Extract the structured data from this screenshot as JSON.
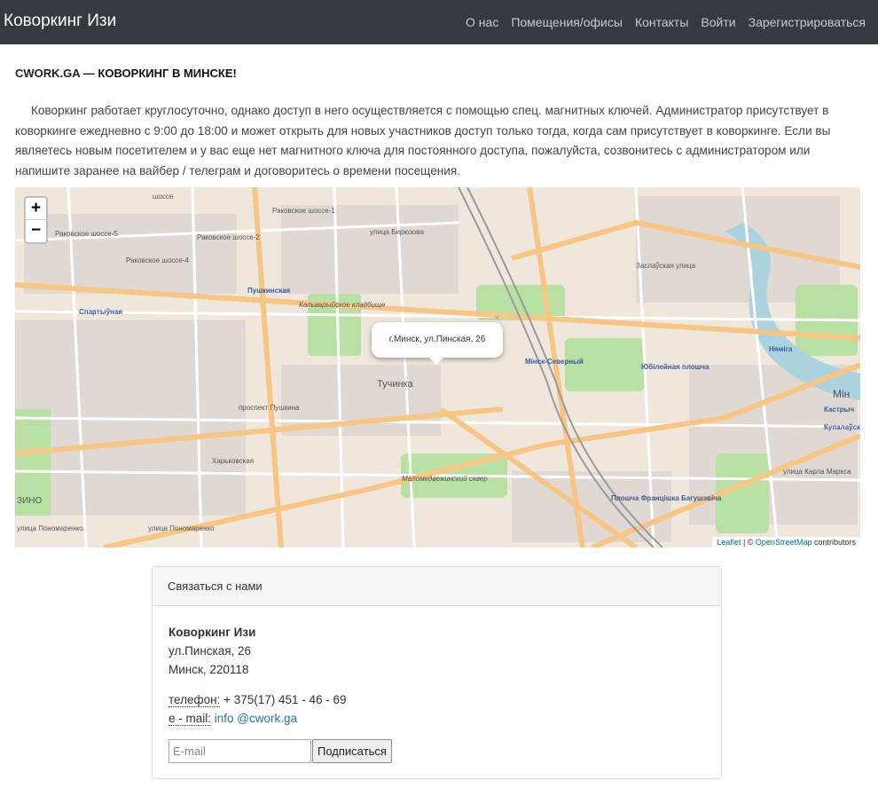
{
  "navbar": {
    "brand": "Коворкинг Изи",
    "links": [
      "О нас",
      "Помещения/офисы",
      "Контакты",
      "Войти",
      "Зарегистрироваться"
    ]
  },
  "headline": {
    "site": "CWORK.GA",
    "dash": " — ",
    "title": "КОВОРКИНГ В МИНСКЕ!"
  },
  "intro": "Коворкинг работает круглосуточно, однако доступ в него осуществляется с помощью спец. магнитных ключей. Администратор присутствует в коворкинге ежедневно с 9:00 до 18:00 и может открыть для новых участников доступ только тогда, когда сам присутствует в коворкинге. Если вы являетесь новым посетителем и у вас еще нет магнитного ключа для постоянного доступа, пожалуйста, созвонитесь с администратором или напишите заранее на вайбер / телеграм и договоритесь о времени посещения.",
  "map": {
    "zoom_in": "+",
    "zoom_out": "−",
    "popup_text": "г.Минск, ул.Пинская, 26",
    "popup_close": "×",
    "attribution_leaflet": "Leaflet",
    "attribution_sep": " | © ",
    "attribution_osm": "OpenStreetMap",
    "attribution_suffix": " contributors",
    "labels": [
      "шоссе",
      "Раковское шоссе-1",
      "Раковское шоссе-5",
      "Раковское шоссе-4",
      "Раковское шоссе-2",
      "улица Бирюзова",
      "Пушкинская",
      "Спартыўная",
      "Кальварыйское кладбище",
      "Тучинка",
      "Мінск-Северный",
      "Юбілейная плошча",
      "Няміга",
      "Заслаўская улица",
      "Купалаўска",
      "Кастрыч",
      "Мін",
      "Маломедвежинский сквер",
      "Плошча Францішка Багушэвіча",
      "Харьковская",
      "улица Пономаренко",
      "улица Пономаренко",
      "ЗИНО",
      "проспект Пушкина",
      "улица Карла Маркса"
    ],
    "colors": {
      "land": "#efe7dc",
      "residential": "#e0d8d2",
      "park": "#b7e0a2",
      "major_road": "#f7c584",
      "minor_road": "#ffffff",
      "rail": "#9a9a9a",
      "water": "#aad3df"
    }
  },
  "contact": {
    "header": "Связаться с нами",
    "company": "Коворкинг Изи",
    "street": "ул.Пинская, 26",
    "city": "Минск, 220118",
    "phone_label": "телефон:",
    "phone": " + 375(17) 451 - 46 - 69",
    "email_label": "e - mail:",
    "email": " info @cwork.ga",
    "email_placeholder": "E-mail",
    "subscribe": "Подписаться"
  }
}
